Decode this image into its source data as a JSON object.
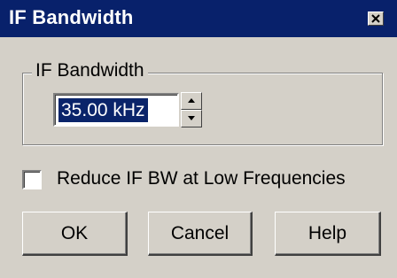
{
  "window": {
    "title": "IF Bandwidth",
    "close_icon": "close-icon"
  },
  "group": {
    "label": "IF Bandwidth",
    "bandwidth_value": "35.00 kHz",
    "spin_up_icon": "arrow-up-icon",
    "spin_down_icon": "arrow-down-icon"
  },
  "option": {
    "label": "Reduce IF BW at Low Frequencies",
    "checked": false
  },
  "buttons": {
    "ok": "OK",
    "cancel": "Cancel",
    "help": "Help"
  },
  "colors": {
    "titlebar": "#08216b",
    "face": "#d4d0c8",
    "selection": "#0a246a"
  }
}
